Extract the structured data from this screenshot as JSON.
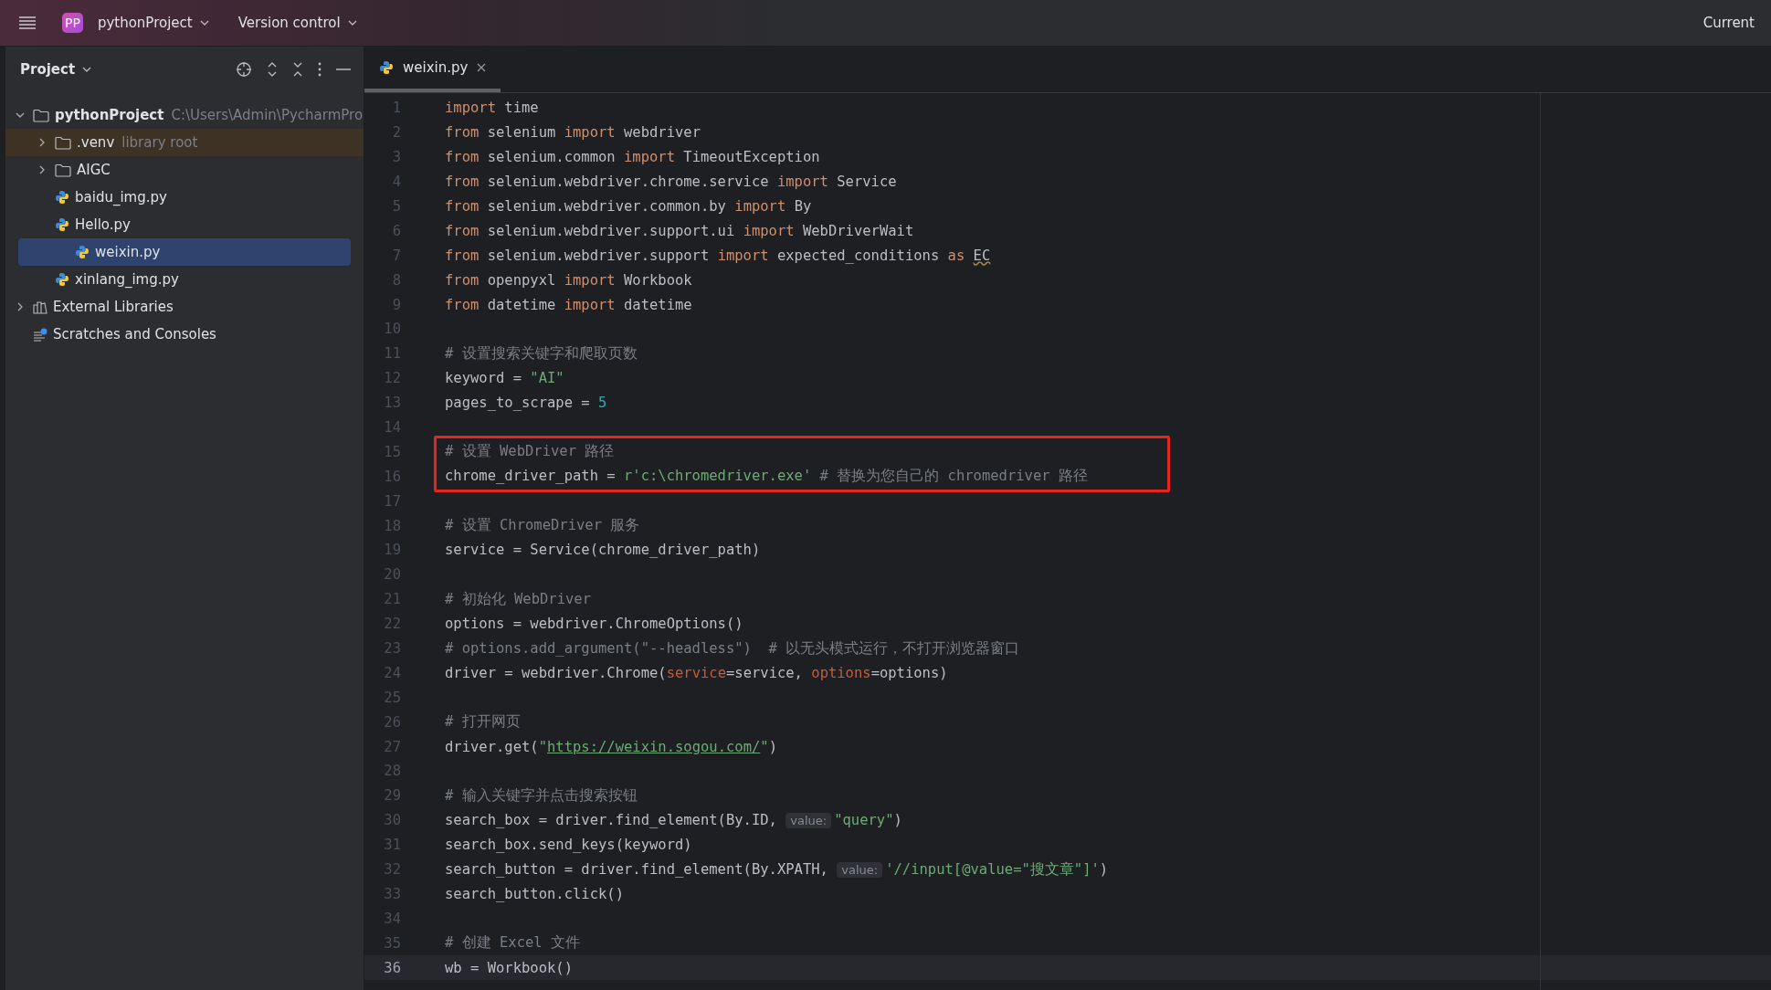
{
  "top_bar": {
    "project_badge": "PP",
    "project_name": "pythonProject",
    "version_control": "Version control",
    "right_label": "Current"
  },
  "project_panel": {
    "title": "Project",
    "tree": [
      {
        "label": "pythonProject",
        "kind": "folder",
        "bold": true,
        "hint": "C:\\Users\\Admin\\PycharmPro",
        "expanded": true,
        "selected": false,
        "excluded": false,
        "children": [
          {
            "label": ".venv",
            "kind": "folder",
            "hint": "library root",
            "expanded": false,
            "selected": false,
            "excluded": true
          },
          {
            "label": "AIGC",
            "kind": "folder",
            "expanded": false,
            "selected": false,
            "excluded": false
          },
          {
            "label": "baidu_img.py",
            "kind": "python",
            "selected": false,
            "excluded": false
          },
          {
            "label": "Hello.py",
            "kind": "python",
            "selected": false,
            "excluded": false
          },
          {
            "label": "weixin.py",
            "kind": "python",
            "selected": true,
            "excluded": false
          },
          {
            "label": "xinlang_img.py",
            "kind": "python",
            "selected": false,
            "excluded": false
          }
        ]
      },
      {
        "label": "External Libraries",
        "kind": "library",
        "expanded": false,
        "selected": false,
        "excluded": false
      },
      {
        "label": "Scratches and Consoles",
        "kind": "scratches",
        "selected": false,
        "excluded": false
      }
    ]
  },
  "tabs": [
    {
      "label": "weixin.py",
      "selected": true
    }
  ],
  "editor": {
    "lines": [
      {
        "n": "1",
        "tokens": [
          {
            "kind": "kw",
            "text": "import"
          },
          {
            "kind": "tx",
            "text": " time"
          }
        ]
      },
      {
        "n": "2",
        "tokens": [
          {
            "kind": "kw",
            "text": "from"
          },
          {
            "kind": "tx",
            "text": " selenium "
          },
          {
            "kind": "kw",
            "text": "import"
          },
          {
            "kind": "tx",
            "text": " webdriver"
          }
        ]
      },
      {
        "n": "3",
        "tokens": [
          {
            "kind": "kw",
            "text": "from"
          },
          {
            "kind": "tx",
            "text": " selenium.common "
          },
          {
            "kind": "kw",
            "text": "import"
          },
          {
            "kind": "tx",
            "text": " TimeoutException"
          }
        ]
      },
      {
        "n": "4",
        "tokens": [
          {
            "kind": "kw",
            "text": "from"
          },
          {
            "kind": "tx",
            "text": " selenium.webdriver.chrome.service "
          },
          {
            "kind": "kw",
            "text": "import"
          },
          {
            "kind": "tx",
            "text": " Service"
          }
        ]
      },
      {
        "n": "5",
        "tokens": [
          {
            "kind": "kw",
            "text": "from"
          },
          {
            "kind": "tx",
            "text": " selenium.webdriver.common.by "
          },
          {
            "kind": "kw",
            "text": "import"
          },
          {
            "kind": "tx",
            "text": " By"
          }
        ]
      },
      {
        "n": "6",
        "tokens": [
          {
            "kind": "kw",
            "text": "from"
          },
          {
            "kind": "tx",
            "text": " selenium.webdriver.support.ui "
          },
          {
            "kind": "kw",
            "text": "import"
          },
          {
            "kind": "tx",
            "text": " WebDriverWait"
          }
        ]
      },
      {
        "n": "7",
        "tokens": [
          {
            "kind": "kw",
            "text": "from"
          },
          {
            "kind": "tx",
            "text": " selenium.webdriver.support "
          },
          {
            "kind": "kw",
            "text": "import"
          },
          {
            "kind": "tx",
            "text": " expected_conditions "
          },
          {
            "kind": "kw",
            "text": "as "
          },
          {
            "kind": "warn",
            "text": "EC"
          }
        ]
      },
      {
        "n": "8",
        "tokens": [
          {
            "kind": "kw",
            "text": "from"
          },
          {
            "kind": "tx",
            "text": " openpyxl "
          },
          {
            "kind": "kw",
            "text": "import"
          },
          {
            "kind": "tx",
            "text": " Workbook"
          }
        ]
      },
      {
        "n": "9",
        "tokens": [
          {
            "kind": "kw",
            "text": "from"
          },
          {
            "kind": "tx",
            "text": " datetime "
          },
          {
            "kind": "kw",
            "text": "import"
          },
          {
            "kind": "tx",
            "text": " datetime"
          }
        ]
      },
      {
        "n": "10"
      },
      {
        "n": "11",
        "tokens": [
          {
            "kind": "cm",
            "text": "# 设置搜索关键字和爬取页数"
          }
        ]
      },
      {
        "n": "12",
        "tokens": [
          {
            "kind": "tx",
            "text": "keyword = "
          },
          {
            "kind": "str",
            "text": "\"AI\""
          }
        ]
      },
      {
        "n": "13",
        "tokens": [
          {
            "kind": "tx",
            "text": "pages_to_scrape = "
          },
          {
            "kind": "num",
            "text": "5"
          }
        ]
      },
      {
        "n": "14"
      },
      {
        "n": "15",
        "highlighted": true,
        "tokens": [
          {
            "kind": "cm",
            "text": "# 设置 WebDriver 路径"
          }
        ]
      },
      {
        "n": "16",
        "highlighted": true,
        "tokens": [
          {
            "kind": "tx",
            "text": "chrome_driver_path = "
          },
          {
            "kind": "str",
            "text": "r'c:\\chromedriver.exe'"
          },
          {
            "kind": "cm",
            "text": " # 替换为您自己的 chromedriver 路径"
          }
        ]
      },
      {
        "n": "17"
      },
      {
        "n": "18",
        "tokens": [
          {
            "kind": "cm",
            "text": "# 设置 ChromeDriver 服务"
          }
        ]
      },
      {
        "n": "19",
        "tokens": [
          {
            "kind": "tx",
            "text": "service = Service(chrome_driver_path)"
          }
        ]
      },
      {
        "n": "20"
      },
      {
        "n": "21",
        "tokens": [
          {
            "kind": "cm",
            "text": "# 初始化 WebDriver"
          }
        ]
      },
      {
        "n": "22",
        "tokens": [
          {
            "kind": "tx",
            "text": "options = webdriver.ChromeOptions()"
          }
        ]
      },
      {
        "n": "23",
        "tokens": [
          {
            "kind": "cm",
            "text": "# options.add_argument(\"--headless\")  # 以无头模式运行，不打开浏览器窗口"
          }
        ]
      },
      {
        "n": "24",
        "tokens": [
          {
            "kind": "tx",
            "text": "driver = webdriver.Chrome("
          },
          {
            "kind": "param",
            "text": "service"
          },
          {
            "kind": "tx",
            "text": "=service, "
          },
          {
            "kind": "param",
            "text": "options"
          },
          {
            "kind": "tx",
            "text": "=options)"
          }
        ]
      },
      {
        "n": "25"
      },
      {
        "n": "26",
        "tokens": [
          {
            "kind": "cm",
            "text": "# 打开网页"
          }
        ]
      },
      {
        "n": "27",
        "tokens": [
          {
            "kind": "tx",
            "text": "driver.get("
          },
          {
            "kind": "str",
            "text": "\""
          },
          {
            "kind": "link",
            "text": "https://weixin.sogou.com/"
          },
          {
            "kind": "str",
            "text": "\""
          },
          {
            "kind": "tx",
            "text": ")"
          }
        ]
      },
      {
        "n": "28"
      },
      {
        "n": "29",
        "tokens": [
          {
            "kind": "cm",
            "text": "# 输入关键字并点击搜索按钮"
          }
        ]
      },
      {
        "n": "30",
        "tokens": [
          {
            "kind": "tx",
            "text": "search_box = driver.find_element(By.ID, "
          },
          {
            "kind": "hint",
            "text": "value:"
          },
          {
            "kind": "str",
            "text": "\"query\""
          },
          {
            "kind": "tx",
            "text": ")"
          }
        ]
      },
      {
        "n": "31",
        "tokens": [
          {
            "kind": "tx",
            "text": "search_box.send_keys(keyword)"
          }
        ]
      },
      {
        "n": "32",
        "tokens": [
          {
            "kind": "tx",
            "text": "search_button = driver.find_element(By.XPATH, "
          },
          {
            "kind": "hint",
            "text": "value:"
          },
          {
            "kind": "str",
            "text": "'//input[@value=\"搜文章\"]'"
          },
          {
            "kind": "tx",
            "text": ")"
          }
        ]
      },
      {
        "n": "33",
        "tokens": [
          {
            "kind": "tx",
            "text": "search_button.click()"
          }
        ]
      },
      {
        "n": "34"
      },
      {
        "n": "35",
        "tokens": [
          {
            "kind": "cm",
            "text": "# 创建 Excel 文件"
          }
        ]
      },
      {
        "n": "36",
        "current": true,
        "tokens": [
          {
            "kind": "tx",
            "text": "wb = Workbook()"
          }
        ]
      }
    ]
  }
}
